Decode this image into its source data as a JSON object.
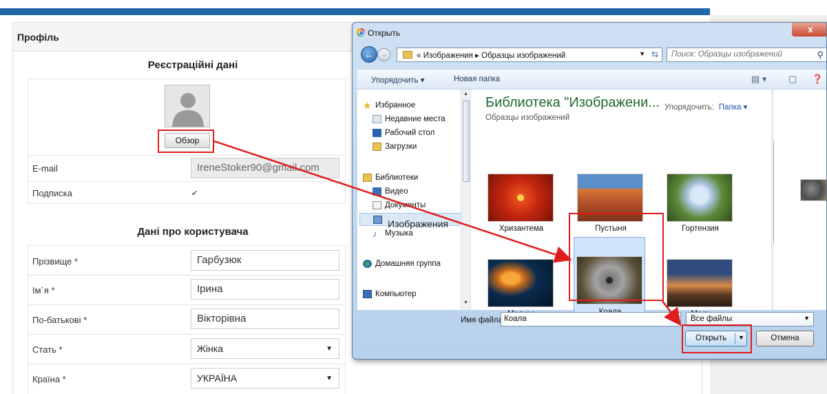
{
  "profile": {
    "title": "Профіль",
    "registration_title": "Реєстраційні дані",
    "browse_label": "Обзор",
    "email_label": "E-mail",
    "email_value": "IreneStoker90@gmail.com",
    "subscription_label": "Подписка",
    "user_data_title": "Дані про користувача",
    "fields": [
      {
        "label": "Прізвище *",
        "value": "Гарбузюк"
      },
      {
        "label": "Ім`я *",
        "value": "Ірина"
      },
      {
        "label": "По-батькові *",
        "value": "Вікторівна"
      }
    ],
    "gender_label": "Стать *",
    "gender_value": "Жінка",
    "country_label": "Країна *",
    "country_value": "УКРАЇНА"
  },
  "dialog": {
    "title": "Открыть",
    "close": "x",
    "address": "« Изображения ▸ Образцы изображений",
    "search_placeholder": "Поиск: Образцы изображений",
    "toolbar": {
      "arrange": "Упорядочить ▾",
      "new_folder": "Новая папка"
    },
    "nav": [
      {
        "label": "Избранное",
        "icon": "star-icon",
        "sub": false
      },
      {
        "label": "Недавние места",
        "icon": "recent-icon",
        "sub": true
      },
      {
        "label": "Рабочий стол",
        "icon": "desktop-icon",
        "sub": true
      },
      {
        "label": "Загрузки",
        "icon": "downloads-icon",
        "sub": true
      },
      {
        "label": "Библиотеки",
        "icon": "library-icon",
        "sub": false
      },
      {
        "label": "Видео",
        "icon": "video-icon",
        "sub": true
      },
      {
        "label": "Документы",
        "icon": "documents-icon",
        "sub": true
      },
      {
        "label": "Изображения",
        "icon": "pictures-icon",
        "sub": true,
        "selected": true
      },
      {
        "label": "Музыка",
        "icon": "music-icon",
        "sub": true
      },
      {
        "label": "Домашняя группа",
        "icon": "homegroup-icon",
        "sub": false
      },
      {
        "label": "Компьютер",
        "icon": "computer-icon",
        "sub": false
      }
    ],
    "library_title": "Библиотека \"Изображени...",
    "library_subtitle": "Образцы изображений",
    "arrange_by_label": "Упорядочить:",
    "arrange_by_value": "Папка ▾",
    "images": [
      {
        "caption": "Хризантема",
        "icon": "chrysanthemum-thumbnail"
      },
      {
        "caption": "Пустыня",
        "icon": "desert-thumbnail"
      },
      {
        "caption": "Гортензия",
        "icon": "hydrangea-thumbnail"
      },
      {
        "caption": "Медуза",
        "icon": "jellyfish-thumbnail"
      },
      {
        "caption": "Коала",
        "icon": "koala-thumbnail",
        "selected": true
      },
      {
        "caption": "Маяк",
        "icon": "lighthouse-thumbnail"
      }
    ],
    "filename_label": "Имя файла:",
    "filename_value": "Коала",
    "filetype_value": "Все файлы",
    "open_label": "Открыть",
    "cancel_label": "Отмена"
  },
  "colors": {
    "accent_bar": "#1f67a6",
    "highlight": "#e01b1b",
    "library_title": "#1e6a30"
  }
}
